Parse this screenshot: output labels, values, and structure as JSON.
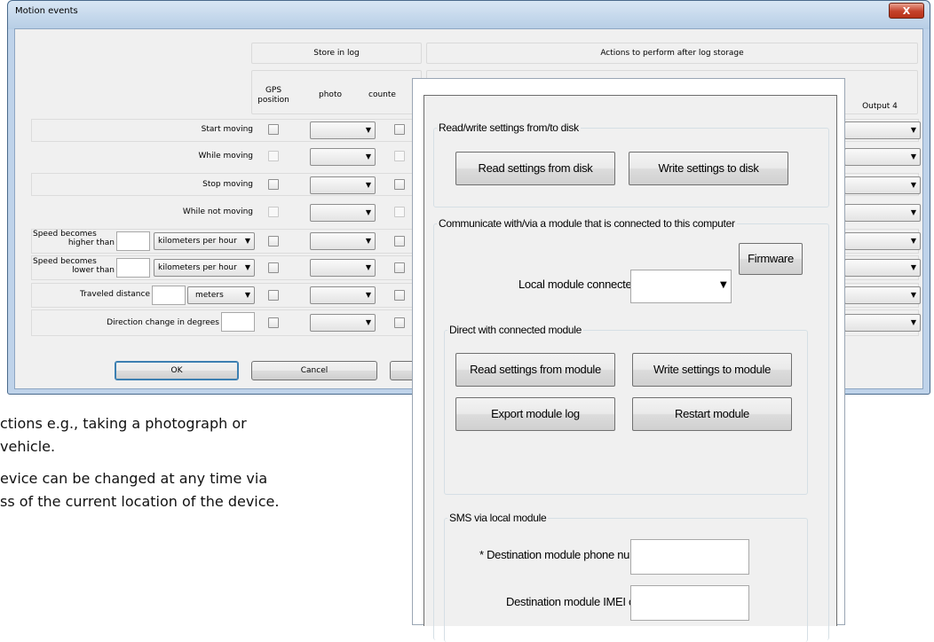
{
  "motion_window": {
    "title": "Motion events",
    "close_glyph": "X",
    "header": {
      "store_in_log": "Store in log",
      "actions_after": "Actions to perform after log storage",
      "col_gps": "GPS position",
      "col_photo": "photo",
      "col_counter": "counte",
      "col_output4": "Output 4"
    },
    "rows": [
      {
        "label": "Start moving"
      },
      {
        "label": "While moving"
      },
      {
        "label": "Stop moving"
      },
      {
        "label": "While not moving"
      },
      {
        "label_line1": "Speed becomes",
        "label_line2": "higher than",
        "unit": "kilometers per hour"
      },
      {
        "label_line1": "Speed becomes",
        "label_line2": "lower than",
        "unit": "kilometers per hour"
      },
      {
        "label": "Traveled distance",
        "unit": "meters"
      },
      {
        "label": "Direction change in degrees"
      }
    ],
    "ok": "OK",
    "cancel": "Cancel"
  },
  "document": {
    "line1": "ctions e.g., taking a photograph or",
    "line2": " vehicle.",
    "line3": "evice can be changed at any time via",
    "line4": "ss of the current location of the device."
  },
  "settings_panel": {
    "group_disk": {
      "title": "Read/write settings from/to disk",
      "read_btn": "Read settings from disk",
      "write_btn": "Write settings to disk"
    },
    "group_comm": {
      "title": "Communicate with/via a module that is connected to this computer",
      "firmware_btn": "Firmware",
      "local_module_label": "Local module connected to",
      "local_module_value": ""
    },
    "group_direct": {
      "title": "Direct with connected module",
      "read_btn": "Read settings from module",
      "write_btn": "Write settings to module",
      "export_btn": "Export module log",
      "restart_btn": "Restart module"
    },
    "group_sms": {
      "title": "SMS via local module",
      "phone_label": "* Destination module phone number",
      "phone_value": "",
      "imei_label": "Destination module IMEI code",
      "imei_value": ""
    }
  },
  "icons": {
    "dropdown_arrow": "chevron-down-icon",
    "close": "close-icon"
  }
}
